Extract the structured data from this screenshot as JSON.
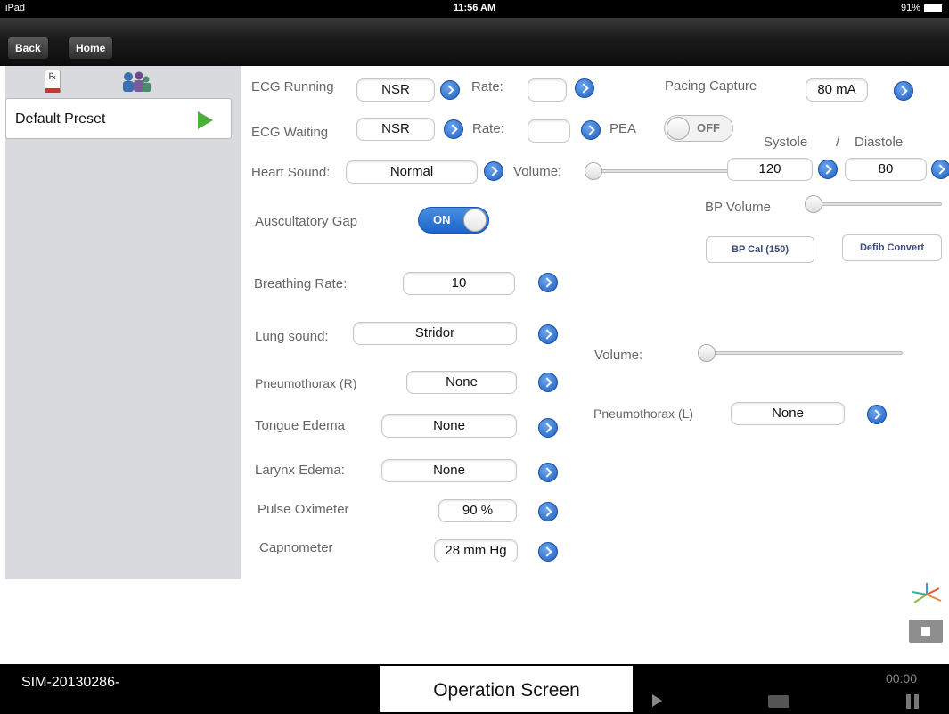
{
  "status_bar": {
    "device": "iPad",
    "time": "11:56 AM",
    "battery": "91%"
  },
  "nav": {
    "back_label": "Back",
    "home_label": "Home"
  },
  "sidebar": {
    "rx_symbol": "℞",
    "preset_label": "Default Preset"
  },
  "ecg_running": {
    "label": "ECG Running",
    "rhythm": "NSR",
    "rate_label": "Rate:",
    "rate_value": ""
  },
  "ecg_waiting": {
    "label": "ECG Waiting",
    "rhythm": "NSR",
    "rate_label": "Rate:",
    "rate_value": ""
  },
  "pacing": {
    "label": "Pacing Capture",
    "value": "80 mA"
  },
  "pea": {
    "label": "PEA",
    "state": "OFF"
  },
  "bp": {
    "systole_label": "Systole",
    "separator": "/",
    "diastole_label": "Diastole",
    "systole_value": "120",
    "diastole_value": "80",
    "volume_label": "BP Volume",
    "volume_level": 0,
    "cal_label": "BP Cal (150)",
    "defib_label": "Defib Convert"
  },
  "heart_sound": {
    "label": "Heart Sound:",
    "value": "Normal",
    "volume_label": "Volume:",
    "volume_level": 0
  },
  "auscultatory_gap": {
    "label": "Auscultatory Gap",
    "state": "ON"
  },
  "breathing_rate": {
    "label": "Breathing Rate:",
    "value": "10"
  },
  "lung_sound": {
    "label": "Lung sound:",
    "value": "Stridor",
    "volume_label": "Volume:",
    "volume_level": 0
  },
  "pneumothorax_r": {
    "label": "Pneumothorax (R)",
    "value": "None"
  },
  "pneumothorax_l": {
    "label": "Pneumothorax (L)",
    "value": "None"
  },
  "tongue_edema": {
    "label": "Tongue Edema",
    "value": "None"
  },
  "larynx_edema": {
    "label": "Larynx Edema:",
    "value": "None"
  },
  "pulse_oximeter": {
    "label": "Pulse Oximeter",
    "value": "90 %"
  },
  "capnometer": {
    "label": "Capnometer",
    "value": "28 mm Hg"
  },
  "bottom_bar": {
    "sim_id": "SIM-20130286-",
    "title": "Operation Screen",
    "timer": "00:00"
  },
  "colors": {
    "accent": "#1f5fc0",
    "play_green": "#4caf3a",
    "sidebar_bg": "#d8dade"
  }
}
